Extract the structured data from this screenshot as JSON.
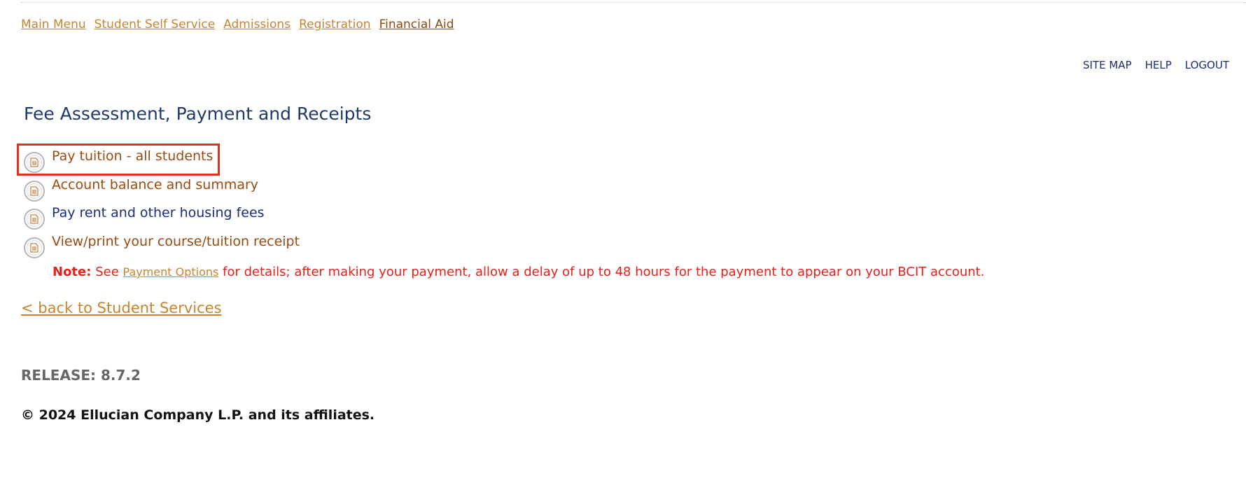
{
  "nav_tabs": [
    {
      "label": "Main Menu"
    },
    {
      "label": "Student Self Service"
    },
    {
      "label": "Admissions"
    },
    {
      "label": "Registration"
    },
    {
      "label": "Financial Aid"
    }
  ],
  "utility_links": {
    "site_map": "SITE MAP",
    "help": "HELP",
    "logout": "LOGOUT"
  },
  "page_title": "Fee Assessment, Payment and Receipts",
  "menu_items": [
    {
      "label": "Pay tuition - all students",
      "icon": "document-icon"
    },
    {
      "label": "Account balance and summary",
      "icon": "document-icon"
    },
    {
      "label": "Pay rent and other housing fees",
      "icon": "document-icon"
    },
    {
      "label": "View/print your course/tuition receipt",
      "icon": "document-icon"
    }
  ],
  "note": {
    "label": "Note:",
    "before": "See",
    "link": "Payment Options",
    "after": "for details; after making your payment, allow a delay of up to 48 hours for the payment to appear on your BCIT account."
  },
  "back_link": "< back to Student Services",
  "release": "RELEASE: 8.7.2",
  "copyright": "© 2024 Ellucian Company L.P. and its affiliates.",
  "colors": {
    "link": "#c8832f",
    "menu_link": "#9a4a10",
    "visited_link": "#1b2d7a",
    "title": "#1e3a6b",
    "note": "#e8201a",
    "highlight": "#e0321f"
  }
}
